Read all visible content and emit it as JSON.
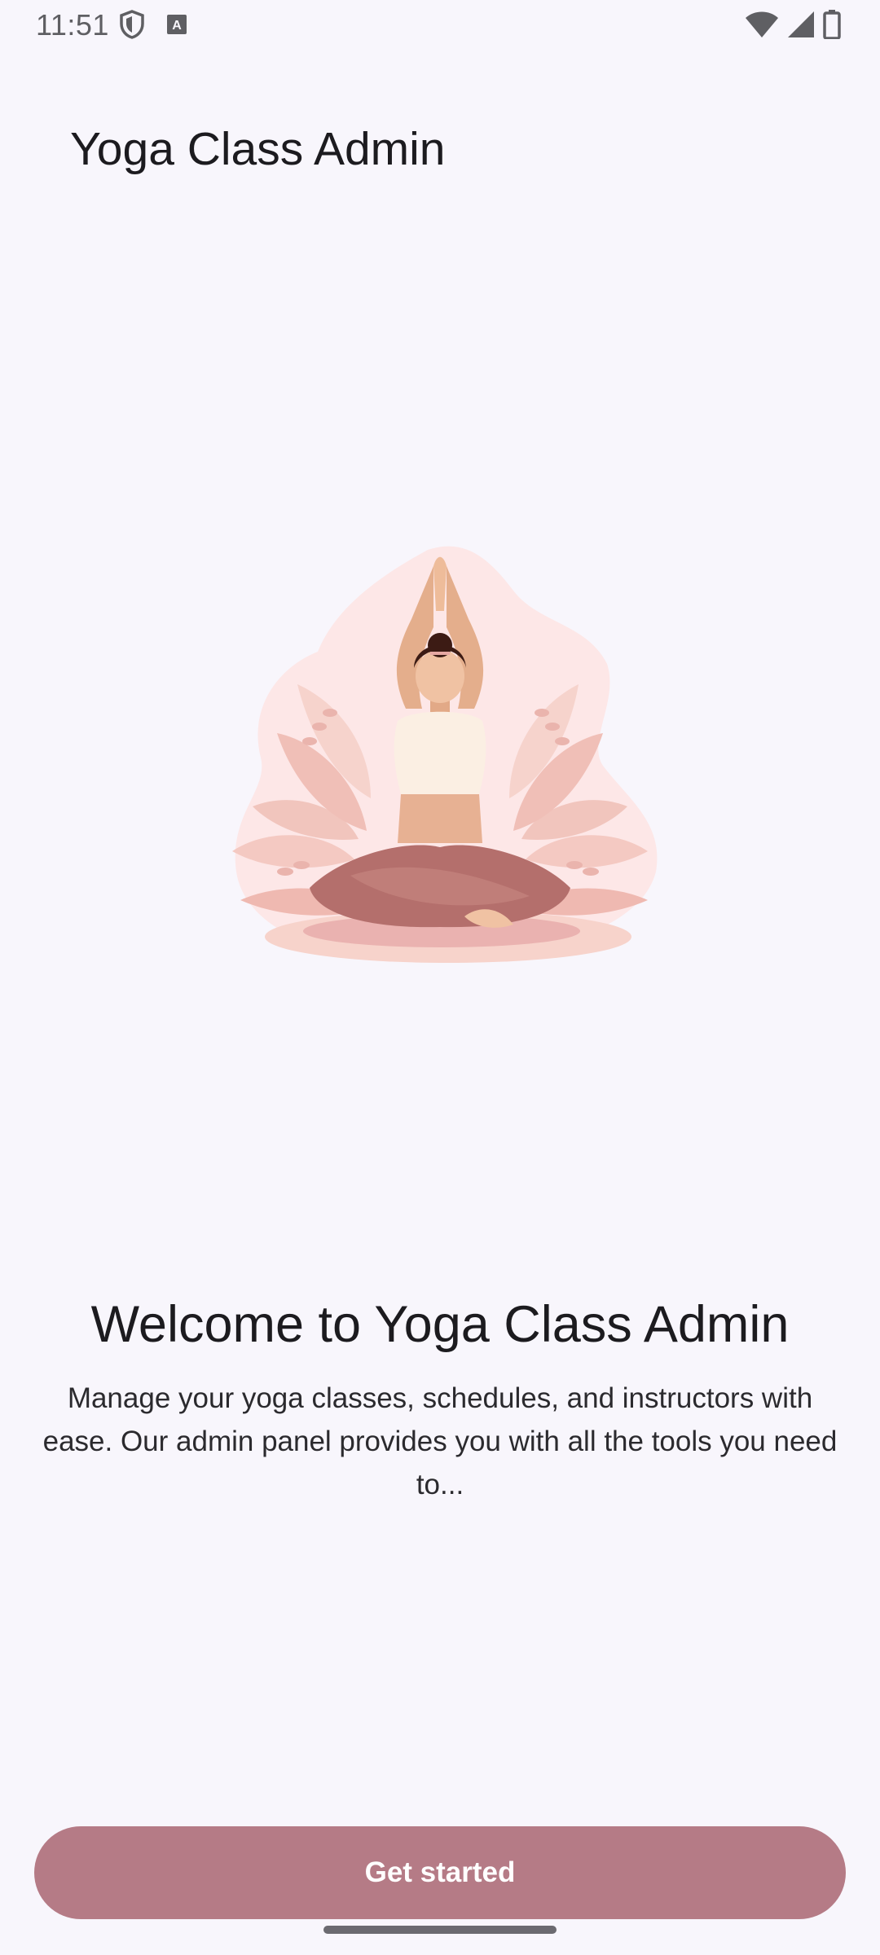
{
  "status_bar": {
    "time": "11:51",
    "left_icons": [
      "shield-icon",
      "keyboard-a-icon"
    ],
    "right_icons": [
      "wifi-icon",
      "cell-signal-icon",
      "battery-icon"
    ]
  },
  "app_bar": {
    "title": "Yoga Class Admin"
  },
  "illustration": {
    "description_icon": "yoga-woman-illustration"
  },
  "welcome": {
    "title": "Welcome to Yoga Class Admin",
    "body": "Manage your yoga classes, schedules, and instructors with ease. Our admin panel provides you with all the tools you need to..."
  },
  "cta": {
    "label": "Get started"
  },
  "colors": {
    "background": "#f8f6fc",
    "button": "#b57b86",
    "button_text": "#ffffff"
  }
}
